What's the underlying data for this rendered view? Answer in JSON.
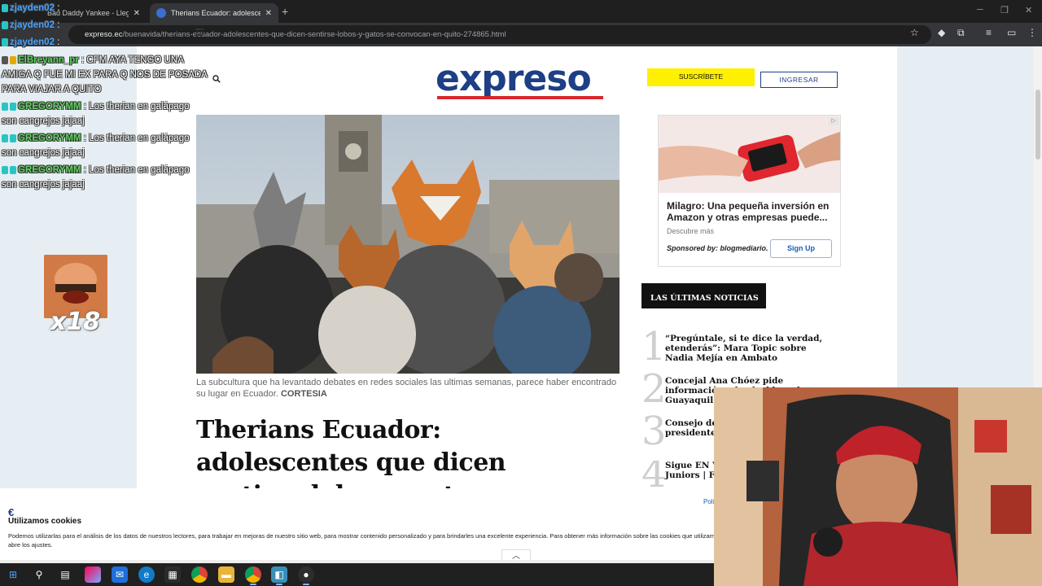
{
  "browser": {
    "tabs": [
      {
        "label": "Bad Daddy Yankee - Llegamos a...",
        "active": false
      },
      {
        "label": "Therians Ecuador: adolescentes q...",
        "active": true
      }
    ],
    "new_tab": "+",
    "url_host": "expreso.ec",
    "url_path": "/buenavida/therians-ecuador-adolescentes-que-dicen-sentirse-lobos-y-gatos-se-convocan-en-quito-274865.html"
  },
  "site": {
    "logo": "expreso",
    "subscribe": "SUSCRÍBETE",
    "login": "INGRESAR",
    "caption": "La subcultura que ha levantado debates en redes sociales las ultimas semanas, parece haber encontrado su lugar en Ecuador.",
    "credit": "CORTESIA",
    "headline": "Therians Ecuador: adolescentes que dicen sentirse lobos y gatos se convocan en Quito"
  },
  "ad": {
    "title": "Milagro: Una pequeña inversión en Amazon y otras empresas puede...",
    "desc": "Descubre más",
    "sponsor": "Sponsored by: blogmediario...",
    "button": "Sign Up"
  },
  "news": {
    "header": "LAS ÚLTIMAS NOTICIAS",
    "items": [
      {
        "num": "1",
        "text": "“Pregúntale, si te dice la verdad, etenderás”: Mara Topic sobre Nadia Mejía en Ambato"
      },
      {
        "num": "2",
        "text": "Concejal Ana Chóez pide información a la alcaldesa de Guayaquil sobre el ATM"
      },
      {
        "num": "3",
        "text": "Consejo de la Judicatura: el presidente tras..."
      },
      {
        "num": "4",
        "text": "Sigue EN VIVO Liga de Quito vs. Juniors | Fase..."
      }
    ]
  },
  "cookie": {
    "title": "Utilizamos cookies",
    "body": "Podemos utilizarlas para el análisis de los datos de nuestros lectores, para trabajar en mejoras de nuestro sitio web, para mostrar contenido personalizado y para brindarles una excelente experiencia. Para obtener más información sobre las cookies que utilizamos, abre los ajustes.",
    "policy": "Polí"
  },
  "chat": [
    {
      "user": "zjayden02",
      "msg": ":"
    },
    {
      "user": "zjayden02",
      "msg": ":"
    },
    {
      "user": "zjayden02",
      "msg": ":"
    },
    {
      "user": "ElBreyann_pr",
      "msg": ": CFM AYA TENGO UNA"
    },
    {
      "user": "",
      "msg": "AMIGA Q FUE MI EX PARA Q NOS DE POSADA"
    },
    {
      "user": "",
      "msg": "PARA VIAJAR A QUITO"
    },
    {
      "user": "GREGORYMM",
      "msg": ": Los therian en galápago"
    },
    {
      "user": "",
      "msg": "son cangrejos jajaaj"
    },
    {
      "user": "GREGORYMM",
      "msg": ": Los therian en galápago"
    },
    {
      "user": "",
      "msg": "son cangrejos jajaaj"
    },
    {
      "user": "GREGORYMM",
      "msg": ": Los therian en galápago"
    },
    {
      "user": "",
      "msg": "son cangrejos jajaaj"
    }
  ],
  "emote_count": "x18",
  "colors": {
    "brand": "#1d3f86",
    "accent_red": "#d9262c",
    "subscribe_bg": "#ffef00",
    "chat_user_green": "#5fd35f",
    "chat_user_blue": "#4aa3ff"
  }
}
